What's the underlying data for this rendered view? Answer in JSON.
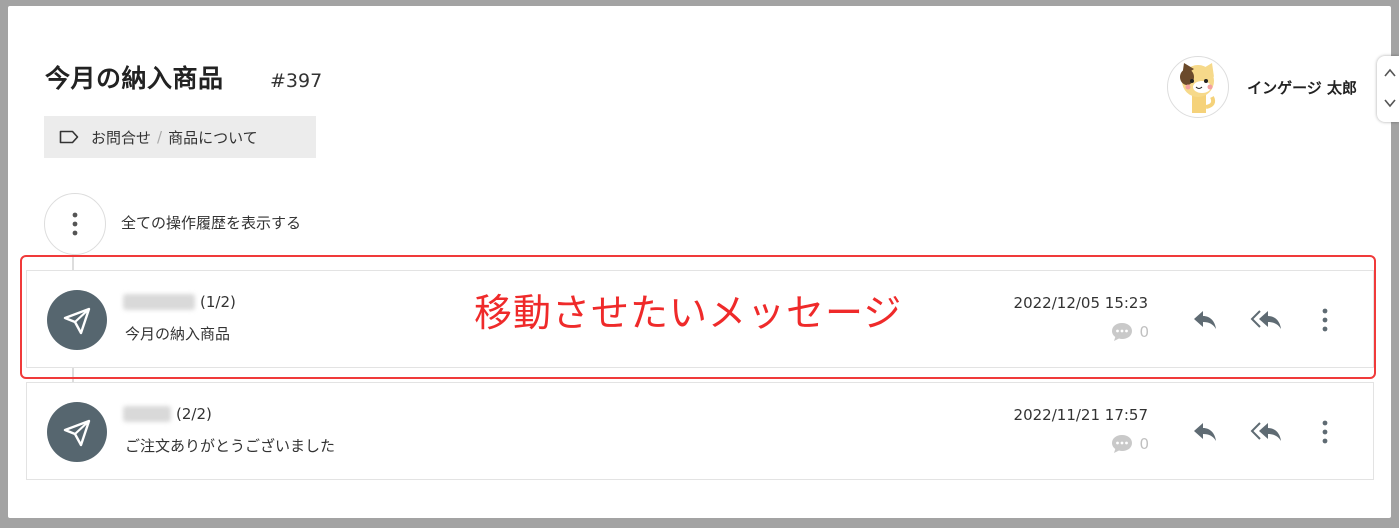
{
  "ticket": {
    "title": "今月の納入商品",
    "number": "#397"
  },
  "tag": {
    "icon": "tag-outline-icon",
    "category": "お問合せ",
    "separator": "/",
    "subcategory": "商品について"
  },
  "user": {
    "name": "インゲージ 太郎",
    "avatar": "cat-avatar"
  },
  "history": {
    "label": "全ての操作履歴を表示する"
  },
  "messages": [
    {
      "sequence": "(1/2)",
      "subject": "今月の納入商品",
      "date": "2022/12/05 15:23",
      "comments": "0"
    },
    {
      "sequence": "(2/2)",
      "subject": "ご注文ありがとうございました",
      "date": "2022/11/21 17:57",
      "comments": "0"
    }
  ],
  "annotation": {
    "text": "移動させたいメッセージ",
    "color": "#ef2a2a"
  },
  "colors": {
    "avatar_bg": "#56666f",
    "icon": "#5f6b73"
  }
}
